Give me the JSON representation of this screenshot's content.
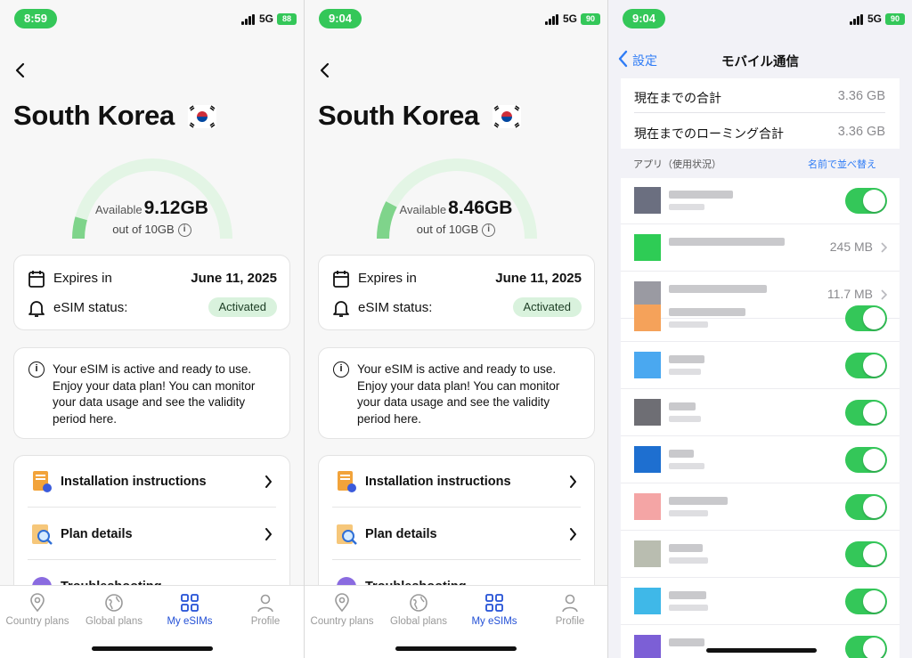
{
  "left_screen": {
    "time": "8:59",
    "network": "5G",
    "battery": "88",
    "country": "South Korea",
    "available_label": "Available",
    "available_value": "9.12GB",
    "total_label": "out of 10GB",
    "used_fraction": 0.088,
    "expires_label": "Expires in",
    "expires_value": "June 11, 2025",
    "status_label": "eSIM status:",
    "status_value": "Activated",
    "message": "Your eSIM is active and ready to use. Enjoy your data plan! You can monitor your data usage and see the validity period here.",
    "menu": [
      "Installation instructions",
      "Plan details",
      "Troubleshooting"
    ],
    "tabs": [
      "Country plans",
      "Global plans",
      "My eSIMs",
      "Profile"
    ]
  },
  "middle_screen": {
    "time": "9:04",
    "network": "5G",
    "battery": "90",
    "country": "South Korea",
    "available_label": "Available",
    "available_value": "8.46GB",
    "total_label": "out of 10GB",
    "used_fraction": 0.154,
    "expires_label": "Expires in",
    "expires_value": "June 11, 2025",
    "status_label": "eSIM status:",
    "status_value": "Activated",
    "message": "Your eSIM is active and ready to use. Enjoy your data plan! You can monitor your data usage and see the validity period here.",
    "menu": [
      "Installation instructions",
      "Plan details",
      "Troubleshooting"
    ],
    "tabs": [
      "Country plans",
      "Global plans",
      "My eSIMs",
      "Profile"
    ]
  },
  "right_screen": {
    "time": "9:04",
    "network": "5G",
    "battery": "90",
    "back_label": "設定",
    "title": "モバイル通信",
    "totals": [
      {
        "label": "現在までの合計",
        "value": "3.36 GB"
      },
      {
        "label": "現在までのローミング合計",
        "value": "3.36 GB"
      }
    ],
    "apps_header": "アプリ（使用状況）",
    "sort_label": "名前で並べ替え",
    "app_sizes": [
      "245 MB",
      "11.7 MB"
    ]
  },
  "colors": {
    "accent_green": "#34c759",
    "gauge_green": "#7fd48b",
    "gauge_track": "#e3f5e5",
    "tab_active": "#2350d6",
    "ios_blue": "#2f7cf6"
  },
  "icons": [
    "back-chevron-icon",
    "korea-flag-icon",
    "calendar-icon",
    "bell-icon",
    "info-icon",
    "document-icon",
    "search-doc-icon",
    "help-icon",
    "chevron-right-icon",
    "location-pin-icon",
    "globe-icon",
    "grid-icon",
    "person-icon"
  ]
}
